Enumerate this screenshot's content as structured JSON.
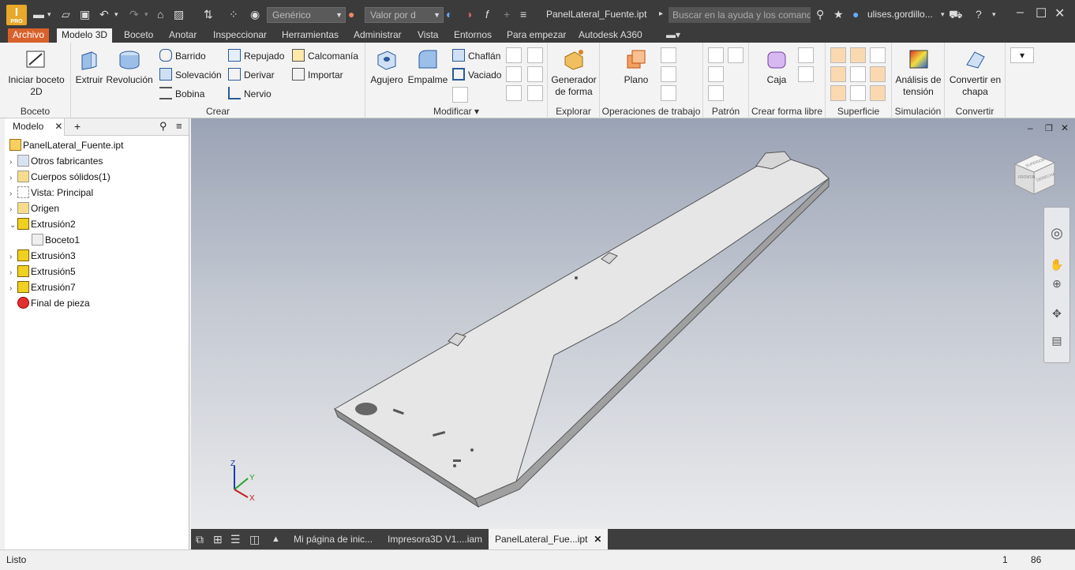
{
  "app": {
    "logo_text": "I",
    "logo_sub": "PRO",
    "appearance_combo": "Genérico",
    "value_combo": "Valor por d",
    "doc_title": "PanelLateral_Fuente.ipt",
    "search_placeholder": "Buscar en la ayuda y los comand",
    "user": "ulises.gordillo...",
    "accent_color": "#d8612c"
  },
  "tabs": [
    "Archivo",
    "Modelo 3D",
    "Boceto",
    "Anotar",
    "Inspeccionar",
    "Herramientas",
    "Administrar",
    "Vista",
    "Entornos",
    "Para empezar",
    "Autodesk A360"
  ],
  "ribbon": {
    "boceto": {
      "btn": "Iniciar boceto 2D",
      "label": "Boceto"
    },
    "crear": {
      "label": "Crear",
      "extruir": "Extruir",
      "revolucion": "Revolución",
      "barrido": "Barrido",
      "solevacion": "Solevación",
      "bobina": "Bobina",
      "repujado": "Repujado",
      "derivar": "Derivar",
      "nervio": "Nervio",
      "calcomania": "Calcomanía",
      "importar": "Importar"
    },
    "modificar": {
      "label": "Modificar ▾",
      "agujero": "Agujero",
      "empalme": "Empalme",
      "chaflan": "Chaflán",
      "vaciado": "Vaciado"
    },
    "explorar": {
      "label": "Explorar",
      "btn": "Generador de forma"
    },
    "operaciones": {
      "label": "Operaciones de trabajo",
      "btn": "Plano"
    },
    "patron": {
      "label": "Patrón"
    },
    "forma_libre": {
      "label": "Crear forma libre",
      "btn": "Caja"
    },
    "superficie": {
      "label": "Superficie"
    },
    "simulacion": {
      "label": "Simulación",
      "btn": "Análisis de tensión"
    },
    "convertir": {
      "label": "Convertir",
      "btn": "Convertir en chapa"
    }
  },
  "browser": {
    "tab": "Modelo",
    "nodes": [
      {
        "label": "PanelLateral_Fuente.ipt",
        "expander": "",
        "icon": "part-icon"
      },
      {
        "label": "Otros fabricantes",
        "expander": "›",
        "icon": "thirdparty-icon"
      },
      {
        "label": "Cuerpos sólidos(1)",
        "expander": "›",
        "icon": "folder-icon"
      },
      {
        "label": "Vista: Principal",
        "expander": "›",
        "icon": "view-icon"
      },
      {
        "label": "Origen",
        "expander": "›",
        "icon": "folder-icon"
      },
      {
        "label": "Extrusión2",
        "expander": "⌄",
        "icon": "extrude-icon"
      },
      {
        "label": "Boceto1",
        "expander": "",
        "icon": "sketch-icon"
      },
      {
        "label": "Extrusión3",
        "expander": "›",
        "icon": "extrude-icon"
      },
      {
        "label": "Extrusión5",
        "expander": "›",
        "icon": "extrude-icon"
      },
      {
        "label": "Extrusión7",
        "expander": "›",
        "icon": "extrude-icon"
      },
      {
        "label": "Final de pieza",
        "expander": "",
        "icon": "end-of-part-icon"
      }
    ]
  },
  "doc_tabs": [
    "Mi página de inic...",
    "Impresora3D V1....iam",
    "PanelLateral_Fue...ipt"
  ],
  "axes": {
    "x": "X",
    "y": "Y",
    "z": "Z"
  },
  "viewcube": {
    "faces": [
      "SUPERIOR",
      "FRONTAL",
      "DERECHA"
    ]
  },
  "status": {
    "text": "Listo",
    "num1": "1",
    "num2": "86"
  }
}
